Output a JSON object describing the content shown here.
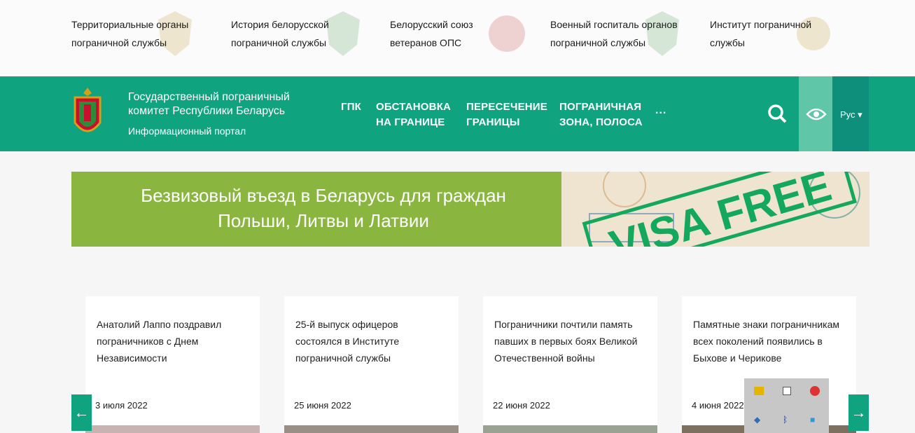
{
  "top_links": [
    "Территориальные органы пограничной службы",
    "История белорусской пограничной службы",
    "Белорусский союз ветеранов ОПС",
    "Военный госпиталь органов пограничной службы",
    "Институт пограничной службы"
  ],
  "header": {
    "title": "Государственный пограничный комитет Республики Беларусь",
    "subtitle": "Информационный портал",
    "nav": [
      "ГПК",
      "ОБСТАНОВКА НА ГРАНИЦЕ",
      "ПЕРЕСЕЧЕНИЕ ГРАНИЦЫ",
      "ПОГРАНИЧНАЯ ЗОНА, ПОЛОСА"
    ],
    "more": "...",
    "language": "Рус"
  },
  "banner": {
    "line1": "Безвизовый въезд в Беларусь для граждан",
    "line2": "Польши, Литвы и Латвии",
    "stamp": "VISA FREE"
  },
  "news": [
    {
      "title": "Анатолий Лаппо поздравил пограничников с Днем Независимости",
      "date": "3 июля 2022"
    },
    {
      "title": "25-й выпуск офицеров состоялся в Институте пограничной службы",
      "date": "25 июня 2022"
    },
    {
      "title": "Пограничники почтили память павших в первых боях Великой Отечественной войны",
      "date": "22 июня 2022"
    },
    {
      "title": "Памятные знаки пограничникам всех поколений появились в Быхове и Черикове",
      "date": "4 июня 2022"
    }
  ],
  "colors": {
    "brand_green": "#0fa37f",
    "banner_green": "#8ab640"
  }
}
